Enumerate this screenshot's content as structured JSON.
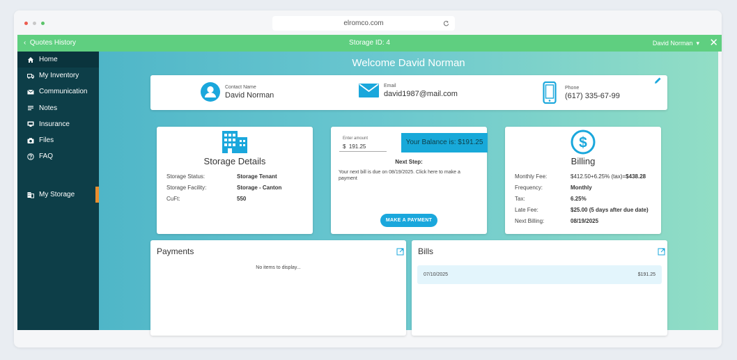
{
  "browser": {
    "url": "elromco.com"
  },
  "topbar": {
    "back_label": "Quotes History",
    "storage_id": "Storage ID: 4",
    "user": "David Norman"
  },
  "sidebar": {
    "items": [
      {
        "label": "Home",
        "icon": "home-icon"
      },
      {
        "label": "My Inventory",
        "icon": "truck-icon"
      },
      {
        "label": "Communication",
        "icon": "mail-icon"
      },
      {
        "label": "Notes",
        "icon": "notes-icon"
      },
      {
        "label": "Insurance",
        "icon": "insurance-icon"
      },
      {
        "label": "Files",
        "icon": "camera-icon"
      },
      {
        "label": "FAQ",
        "icon": "help-icon"
      }
    ],
    "active_item": {
      "label": "My Storage",
      "icon": "building-icon"
    },
    "accent": "#e98e2d"
  },
  "main": {
    "welcome": "Welcome David Norman"
  },
  "contact": {
    "name_label": "Contact Name",
    "name": "David Norman",
    "email_label": "Email",
    "email": "david1987@mail.com",
    "phone_label": "Phone",
    "phone": "(617) 335-67-99"
  },
  "storage_details": {
    "title": "Storage Details",
    "status_label": "Storage Status:",
    "status": "Storage Tenant",
    "facility_label": "Storage Facility:",
    "facility": "Storage - Canton",
    "cuft_label": "CuFt:",
    "cuft": "550"
  },
  "payment": {
    "amount_label": "Enter amount",
    "currency": "$",
    "amount": "191.25",
    "balance": "Your Balance is:  $191.25",
    "next_step_title": "Next Step:",
    "next_step_text": "Your next bill is due on 08/19/2025. Click here to make a payment",
    "button": "MAKE A PAYMENT"
  },
  "billing": {
    "title": "Billing",
    "monthly_fee_label": "Monthly Fee:",
    "monthly_fee_calc": "$412.50+6.25% (tax)=",
    "monthly_fee_total": "$438.28",
    "frequency_label": "Frequency:",
    "frequency": "Monthly",
    "tax_label": "Tax:",
    "tax": "6.25%",
    "late_fee_label": "Late Fee:",
    "late_fee": "$25.00 (5 days after due date)",
    "next_billing_label": "Next Billing:",
    "next_billing": "08/19/2025"
  },
  "payments": {
    "title": "Payments",
    "empty": "No items to display..."
  },
  "bills": {
    "title": "Bills",
    "rows": [
      {
        "date": "07/10/2025",
        "amount": "$191.25"
      }
    ]
  },
  "colors": {
    "topbar": "#5fcf80",
    "sidebar": "#0d3e48",
    "accent_blue": "#1aa7dc"
  }
}
